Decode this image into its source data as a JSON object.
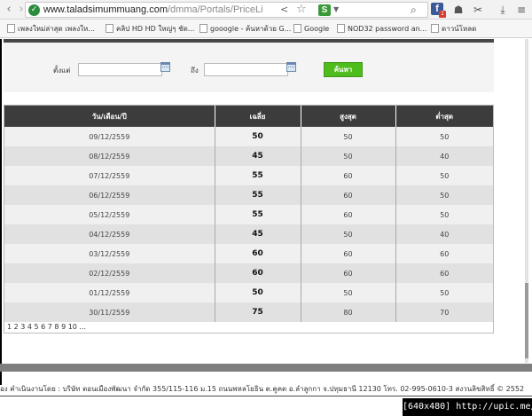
{
  "browser": {
    "url_host": "www.taladsimummuang.com",
    "url_path": "/dmma/Portals/PriceLi",
    "icons": [
      "back-icon",
      "forward-icon",
      "secure-icon",
      "share-icon",
      "star-icon",
      "search-icon",
      "facebook-icon",
      "scissors-icon",
      "download-icon",
      "menu-icon"
    ],
    "extension_s": "S",
    "facebook_label": "f",
    "facebook_badge": "1"
  },
  "bookmarks": [
    {
      "label": "เพลงใหม่ล่าสุด เพลงให..."
    },
    {
      "label": "คลิป HD HD ใหญ่ๆ ชัด..."
    },
    {
      "label": "gooogle - ค้นหาด้วย G..."
    },
    {
      "label": "Google"
    },
    {
      "label": "NOD32 password an..."
    },
    {
      "label": "ดาวน์โหลด"
    }
  ],
  "filter": {
    "from_label": "ตั้งแต่",
    "to_label": "ถึง",
    "search_label": "ค้นหา"
  },
  "table": {
    "headers": [
      "วัน/เดือน/ปี",
      "เฉลี่ย",
      "สูงสุด",
      "ต่ำสุด"
    ],
    "rows": [
      [
        "09/12/2559",
        "50",
        "50",
        "50"
      ],
      [
        "08/12/2559",
        "45",
        "50",
        "40"
      ],
      [
        "07/12/2559",
        "55",
        "60",
        "50"
      ],
      [
        "06/12/2559",
        "55",
        "60",
        "50"
      ],
      [
        "05/12/2559",
        "55",
        "60",
        "50"
      ],
      [
        "04/12/2559",
        "45",
        "50",
        "40"
      ],
      [
        "03/12/2559",
        "60",
        "60",
        "60"
      ],
      [
        "02/12/2559",
        "60",
        "60",
        "60"
      ],
      [
        "01/12/2559",
        "50",
        "50",
        "50"
      ],
      [
        "30/11/2559",
        "75",
        "80",
        "70"
      ]
    ],
    "pager": "1 2 3 4 5 6 7 8 9 10 ..."
  },
  "footer": {
    "text": "อง คำเนินงานโดย : บริษัท ตอนเมืองพัฒนา จำกัด 355/115-116 ม.15 ถนนพหลโยธิน ต.คูคต อ.ลำลูกกา จ.ปทุมธานี 12130 โทร. 02-995-0610-3 สงวนลิขสิทธิ์ © 2552"
  },
  "watermark": "[640x480] http://upic.me/"
}
